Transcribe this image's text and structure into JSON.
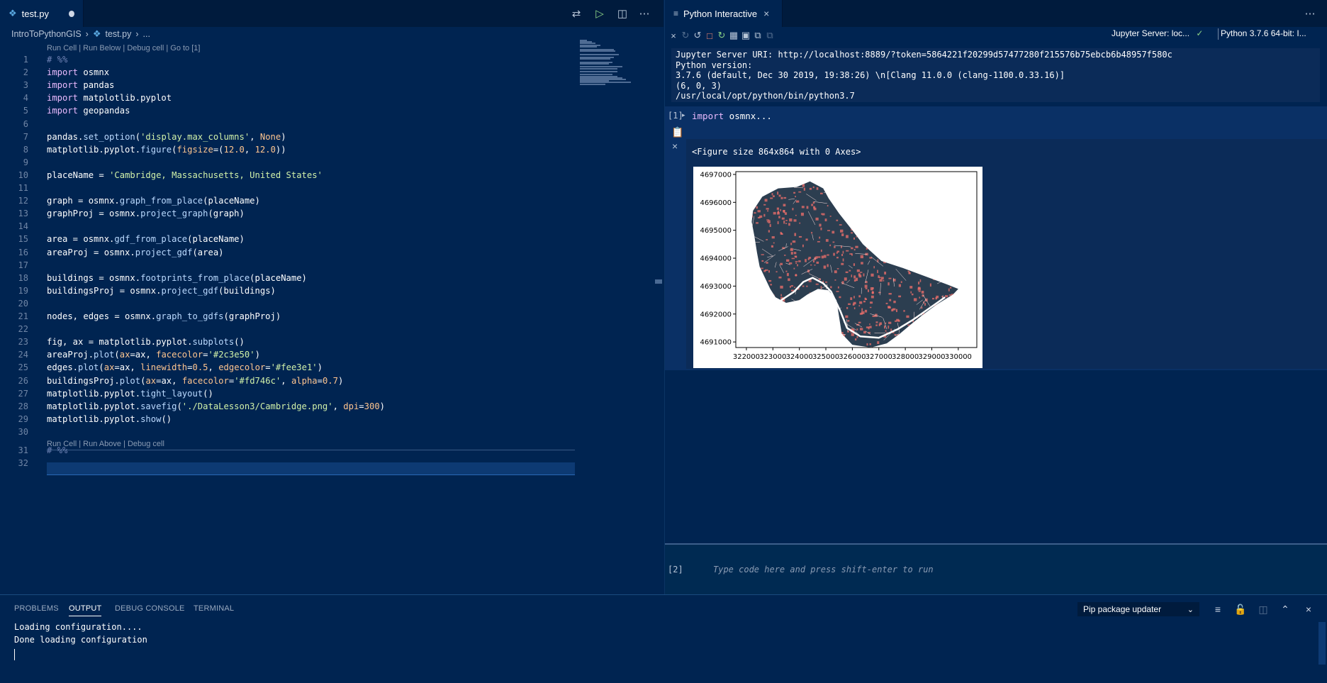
{
  "editor": {
    "tab_label": "test.py",
    "breadcrumb": [
      "IntroToPythonGIS",
      "test.py",
      "..."
    ],
    "code_lens_top": "Run Cell | Run Below | Debug cell | Go to [1]",
    "code_lens_bottom": "Run Cell | Run Above | Debug cell",
    "lines": [
      {
        "n": "1",
        "html": "<span class='cmt'># %%</span>"
      },
      {
        "n": "2",
        "html": "<span class='kw'>import</span> osmnx"
      },
      {
        "n": "3",
        "html": "<span class='kw'>import</span> pandas"
      },
      {
        "n": "4",
        "html": "<span class='kw'>import</span> matplotlib.pyplot"
      },
      {
        "n": "5",
        "html": "<span class='kw'>import</span> geopandas"
      },
      {
        "n": "6",
        "html": ""
      },
      {
        "n": "7",
        "html": "pandas.<span class='fn'>set_option</span>(<span class='str'>'display.max_columns'</span>, <span class='num'>None</span>)"
      },
      {
        "n": "8",
        "html": "matplotlib.pyplot.<span class='fn'>figure</span>(<span class='param'>figsize</span>=(<span class='num'>12.0</span>, <span class='num'>12.0</span>))"
      },
      {
        "n": "9",
        "html": ""
      },
      {
        "n": "10",
        "html": "placeName = <span class='str'>'Cambridge, Massachusetts, United States'</span>"
      },
      {
        "n": "11",
        "html": ""
      },
      {
        "n": "12",
        "html": "graph = osmnx.<span class='fn'>graph_from_place</span>(placeName)"
      },
      {
        "n": "13",
        "html": "graphProj = osmnx.<span class='fn'>project_graph</span>(graph)"
      },
      {
        "n": "14",
        "html": ""
      },
      {
        "n": "15",
        "html": "area = osmnx.<span class='fn'>gdf_from_place</span>(placeName)"
      },
      {
        "n": "16",
        "html": "areaProj = osmnx.<span class='fn'>project_gdf</span>(area)"
      },
      {
        "n": "17",
        "html": ""
      },
      {
        "n": "18",
        "html": "buildings = osmnx.<span class='fn'>footprints_from_place</span>(placeName)"
      },
      {
        "n": "19",
        "html": "buildingsProj = osmnx.<span class='fn'>project_gdf</span>(buildings)"
      },
      {
        "n": "20",
        "html": ""
      },
      {
        "n": "21",
        "html": "nodes, edges = osmnx.<span class='fn'>graph_to_gdfs</span>(graphProj)"
      },
      {
        "n": "22",
        "html": ""
      },
      {
        "n": "23",
        "html": "fig, ax = matplotlib.pyplot.<span class='fn'>subplots</span>()"
      },
      {
        "n": "24",
        "html": "areaProj.<span class='fn'>plot</span>(<span class='param'>ax</span>=ax, <span class='param'>facecolor</span>=<span class='str'>'#2c3e50'</span>)"
      },
      {
        "n": "25",
        "html": "edges.<span class='fn'>plot</span>(<span class='param'>ax</span>=ax, <span class='param'>linewidth</span>=<span class='num'>0.5</span>, <span class='param'>edgecolor</span>=<span class='str'>'#fee3e1'</span>)"
      },
      {
        "n": "26",
        "html": "buildingsProj.<span class='fn'>plot</span>(<span class='param'>ax</span>=ax, <span class='param'>facecolor</span>=<span class='str'>'#fd746c'</span>, <span class='param'>alpha</span>=<span class='num'>0.7</span>)"
      },
      {
        "n": "27",
        "html": "matplotlib.pyplot.<span class='fn'>tight_layout</span>()"
      },
      {
        "n": "28",
        "html": "matplotlib.pyplot.<span class='fn'>savefig</span>(<span class='str'>'./DataLesson3/Cambridge.png'</span>, <span class='param'>dpi</span>=<span class='num'>300</span>)"
      },
      {
        "n": "29",
        "html": "matplotlib.pyplot.<span class='fn'>show</span>()"
      },
      {
        "n": "30",
        "html": ""
      },
      {
        "n": "31",
        "html": "<span class='cmt'># %%</span>"
      },
      {
        "n": "32",
        "html": ""
      }
    ]
  },
  "interactive": {
    "tab_label": "Python Interactive",
    "server_label": "Jupyter Server: loc...",
    "kernel_label": "Python 3.7.6 64-bit: I...",
    "sys_info": "Jupyter Server URI: http://localhost:8889/?token=5864221f20299d57477280f215576b75ebcb6b48957f580c\nPython version:\n3.7.6 (default, Dec 30 2019, 19:38:26) \\n[Clang 11.0.0 (clang-1100.0.33.16)]\n(6, 0, 3)\n/usr/local/opt/python/bin/python3.7",
    "cell_prompt": "[1]",
    "cell_code_kw": "import",
    "cell_code_rest": " osmnx...",
    "output_text": "<Figure size 864x864 with 0 Axes>",
    "input_prompt": "[2]",
    "input_placeholder": "Type code here and press shift-enter to run"
  },
  "chart_data": {
    "type": "map",
    "title": "",
    "xlabel": "",
    "ylabel": "",
    "x_ticks": [
      322000,
      323000,
      324000,
      325000,
      326000,
      327000,
      328000,
      329000,
      330000
    ],
    "y_ticks": [
      4691000,
      4692000,
      4693000,
      4694000,
      4695000,
      4696000,
      4697000
    ],
    "xlim": [
      321600,
      330700
    ],
    "ylim": [
      4690800,
      4697100
    ],
    "layers": [
      {
        "name": "areaProj",
        "facecolor": "#2c3e50"
      },
      {
        "name": "edges",
        "edgecolor": "#fee3e1",
        "linewidth": 0.5
      },
      {
        "name": "buildingsProj",
        "facecolor": "#fd746c",
        "alpha": 0.7
      }
    ],
    "area_outline": [
      [
        322250,
        4695700
      ],
      [
        322600,
        4696200
      ],
      [
        323200,
        4696500
      ],
      [
        323900,
        4696550
      ],
      [
        324400,
        4696750
      ],
      [
        324900,
        4696500
      ],
      [
        325100,
        4696150
      ],
      [
        325500,
        4695600
      ],
      [
        326000,
        4695000
      ],
      [
        326400,
        4694500
      ],
      [
        327100,
        4693900
      ],
      [
        327900,
        4693650
      ],
      [
        328900,
        4693300
      ],
      [
        329600,
        4693050
      ],
      [
        330000,
        4692900
      ],
      [
        329800,
        4692700
      ],
      [
        329200,
        4692350
      ],
      [
        328700,
        4692000
      ],
      [
        328300,
        4691700
      ],
      [
        327800,
        4691300
      ],
      [
        327300,
        4690950
      ],
      [
        326700,
        4690800
      ],
      [
        326000,
        4690900
      ],
      [
        325600,
        4691300
      ],
      [
        325500,
        4691900
      ],
      [
        325400,
        4692500
      ],
      [
        325100,
        4692850
      ],
      [
        324700,
        4692900
      ],
      [
        324300,
        4692700
      ],
      [
        324000,
        4692500
      ],
      [
        323500,
        4692400
      ],
      [
        323100,
        4692600
      ],
      [
        322900,
        4692900
      ],
      [
        322700,
        4693300
      ],
      [
        322500,
        4693700
      ],
      [
        322400,
        4694200
      ],
      [
        322300,
        4694800
      ],
      [
        322200,
        4695300
      ]
    ],
    "river_line": [
      [
        323100,
        4692350
      ],
      [
        323400,
        4692550
      ],
      [
        323800,
        4692800
      ],
      [
        324150,
        4693150
      ],
      [
        324500,
        4693300
      ],
      [
        324900,
        4693100
      ],
      [
        325200,
        4692800
      ],
      [
        325550,
        4692100
      ],
      [
        325800,
        4691500
      ],
      [
        326300,
        4691200
      ],
      [
        327000,
        4691150
      ],
      [
        327700,
        4691450
      ],
      [
        328300,
        4691800
      ],
      [
        328900,
        4692200
      ],
      [
        329500,
        4692600
      ]
    ]
  },
  "panel": {
    "tabs": [
      "PROBLEMS",
      "OUTPUT",
      "DEBUG CONSOLE",
      "TERMINAL"
    ],
    "active_tab": "OUTPUT",
    "select_value": "Pip package updater",
    "output_lines": [
      "Loading configuration....",
      "Done loading configuration"
    ]
  }
}
